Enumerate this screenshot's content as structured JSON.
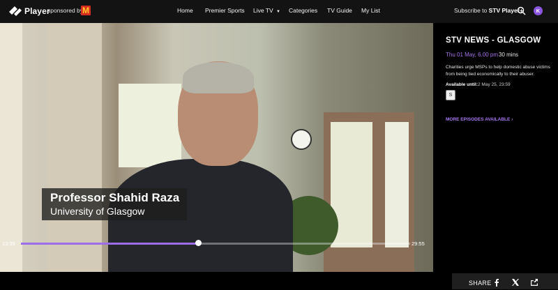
{
  "header": {
    "logo_text": "Player",
    "sponsored_by": "sponsored by",
    "sponsor_logo_letter": "M",
    "nav": [
      "Home",
      "Premier Sports",
      "Live TV",
      "Categories",
      "TV Guide",
      "My List"
    ],
    "subscribe_prefix": "Subscribe to",
    "subscribe_brand": "STV Player+",
    "avatar_initial": "K"
  },
  "video": {
    "lower_third_name": "Professor Shahid Raza",
    "lower_third_org": "University of Glasgow",
    "current_time": "13:35",
    "duration": "29:55",
    "progress_fraction": 0.455
  },
  "panel": {
    "title": "STV NEWS - GLASGOW",
    "date": "Thu 01 May, 6.00 pm",
    "length": "30 mins",
    "description": "Charities urge MSPs to help domestic abuse victims from being tied economically to their abuser.",
    "available_label": "Available until:",
    "available_value": "2 May 25, 23:59",
    "subtitle_badge": "S",
    "more_episodes": "MORE EPISODES AVAILABLE"
  },
  "share": {
    "label": "SHARE",
    "icons": [
      "facebook-icon",
      "x-icon",
      "share-external-icon"
    ]
  },
  "colors": {
    "accent": "#9b6de8",
    "topbar": "#131313",
    "sponsor_red": "#d62b1f",
    "sponsor_yellow": "#ffc72c"
  }
}
